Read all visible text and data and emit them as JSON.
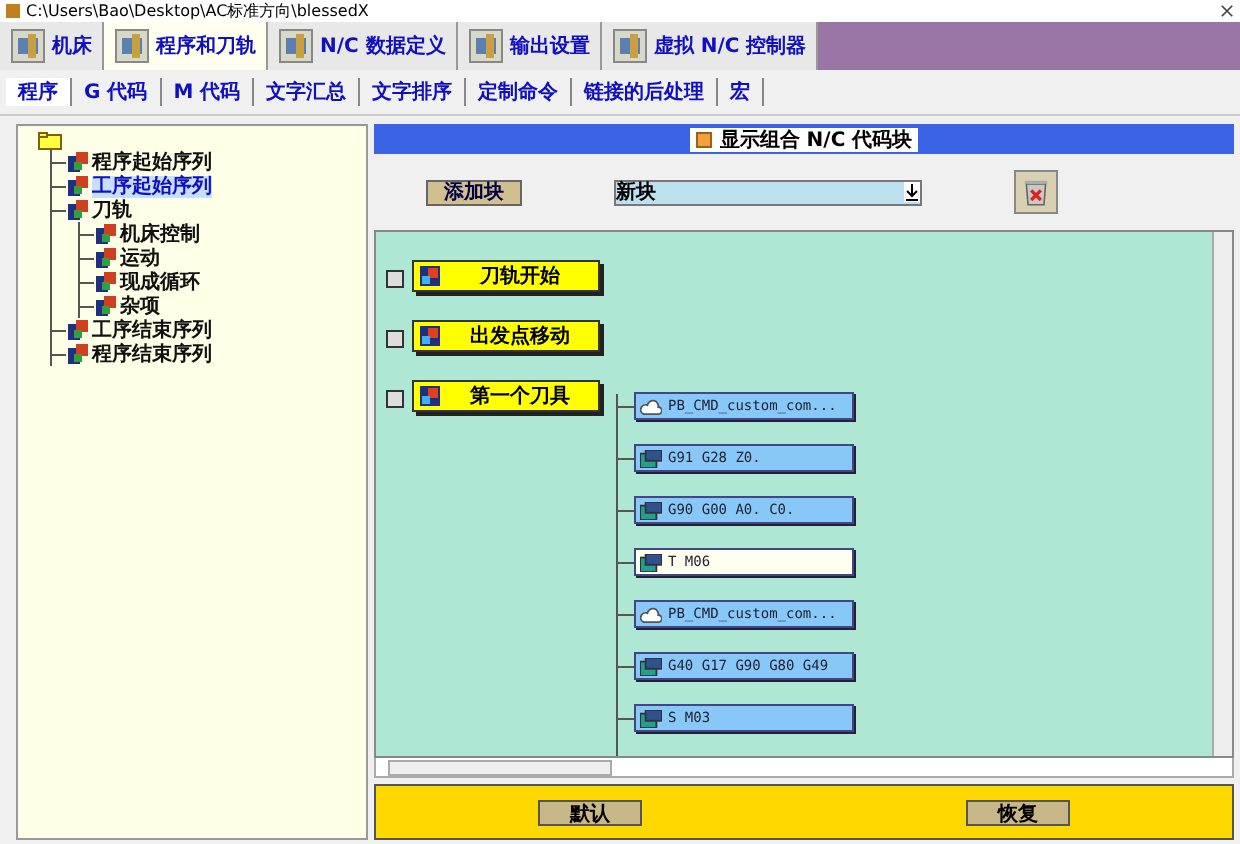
{
  "window": {
    "title": "C:\\Users\\Bao\\Desktop\\AC标准方向\\blessedX"
  },
  "tabs": [
    {
      "label": "机床",
      "selected": false
    },
    {
      "label": "程序和刀轨",
      "selected": true
    },
    {
      "label": "N/C 数据定义",
      "selected": false
    },
    {
      "label": "输出设置",
      "selected": false
    },
    {
      "label": "虚拟 N/C 控制器",
      "selected": false
    }
  ],
  "subtabs": [
    {
      "label": "程序",
      "selected": true
    },
    {
      "label": "G 代码",
      "selected": false
    },
    {
      "label": "M 代码",
      "selected": false
    },
    {
      "label": "文字汇总",
      "selected": false
    },
    {
      "label": "文字排序",
      "selected": false
    },
    {
      "label": "定制命令",
      "selected": false
    },
    {
      "label": "链接的后处理",
      "selected": false
    },
    {
      "label": "宏",
      "selected": false
    }
  ],
  "tree": {
    "children": [
      {
        "label": "程序起始序列",
        "selected": false
      },
      {
        "label": "工序起始序列",
        "selected": true
      },
      {
        "label": "刀轨",
        "selected": false,
        "children": [
          {
            "label": "机床控制",
            "selected": false
          },
          {
            "label": "运动",
            "selected": false
          },
          {
            "label": "现成循环",
            "selected": false
          },
          {
            "label": "杂项",
            "selected": false
          }
        ]
      },
      {
        "label": "工序结束序列",
        "selected": false
      },
      {
        "label": "程序结束序列",
        "selected": false
      }
    ]
  },
  "header": {
    "checkbox_label": "显示组合 N/C 代码块",
    "checked": false
  },
  "toolbar": {
    "add_button": "添加块",
    "block_select": "新块"
  },
  "events": [
    {
      "label": "刀轨开始"
    },
    {
      "label": "出发点移动"
    },
    {
      "label": "第一个刀具",
      "blocks": [
        {
          "kind": "command",
          "text": "PB_CMD_custom_com...",
          "selected": false
        },
        {
          "kind": "code",
          "text": "G91 G28 Z0.",
          "selected": false
        },
        {
          "kind": "code",
          "text": "G90 G00 A0. C0.",
          "selected": false
        },
        {
          "kind": "code",
          "text": "T M06",
          "selected": true
        },
        {
          "kind": "command",
          "text": "PB_CMD_custom_com...",
          "selected": false
        },
        {
          "kind": "code",
          "text": "G40 G17 G90 G80 G49",
          "selected": false
        },
        {
          "kind": "code",
          "text": "S M03",
          "selected": false
        }
      ]
    }
  ],
  "buttons": [
    "默认",
    "恢复"
  ]
}
